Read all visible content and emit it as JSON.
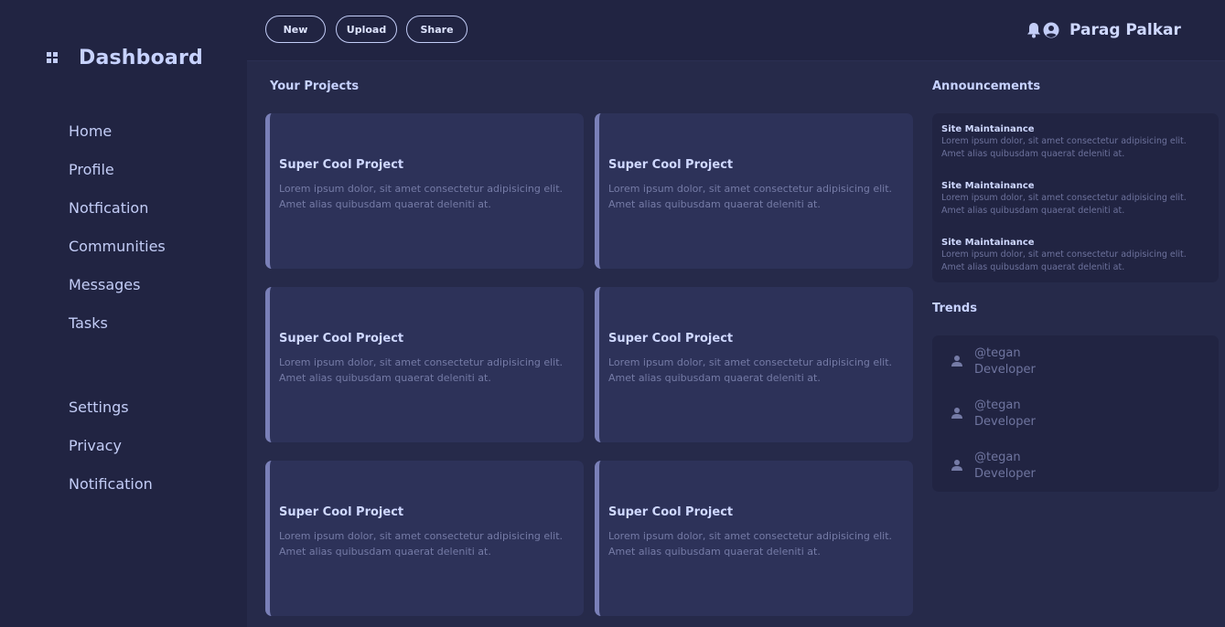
{
  "brand": {
    "title": "Dashboard",
    "icon": "grid-icon"
  },
  "nav": {
    "primary": [
      {
        "label": "Home"
      },
      {
        "label": "Profile"
      },
      {
        "label": "Notfication"
      },
      {
        "label": "Communities"
      },
      {
        "label": "Messages"
      },
      {
        "label": "Tasks"
      }
    ],
    "secondary": [
      {
        "label": "Settings"
      },
      {
        "label": "Privacy"
      },
      {
        "label": "Notification"
      }
    ]
  },
  "header": {
    "buttons": {
      "new": "New",
      "upload": "Upload",
      "share": "Share"
    },
    "user_name": "Parag Palkar",
    "icons": [
      "bell-icon",
      "user-circle-icon"
    ]
  },
  "projects": {
    "title": "Your Projects",
    "items": [
      {
        "title": "Super Cool Project",
        "line1": "Lorem ipsum dolor, sit amet consectetur adipisicing elit.",
        "line2": "Amet alias quibusdam quaerat deleniti at."
      },
      {
        "title": "Super Cool Project",
        "line1": "Lorem ipsum dolor, sit amet consectetur adipisicing elit.",
        "line2": "Amet alias quibusdam quaerat deleniti at."
      },
      {
        "title": "Super Cool Project",
        "line1": "Lorem ipsum dolor, sit amet consectetur adipisicing elit.",
        "line2": "Amet alias quibusdam quaerat deleniti at."
      },
      {
        "title": "Super Cool Project",
        "line1": "Lorem ipsum dolor, sit amet consectetur adipisicing elit.",
        "line2": "Amet alias quibusdam quaerat deleniti at."
      },
      {
        "title": "Super Cool Project",
        "line1": "Lorem ipsum dolor, sit amet consectetur adipisicing elit.",
        "line2": "Amet alias quibusdam quaerat deleniti at."
      },
      {
        "title": "Super Cool Project",
        "line1": "Lorem ipsum dolor, sit amet consectetur adipisicing elit.",
        "line2": "Amet alias quibusdam quaerat deleniti at."
      }
    ]
  },
  "announcements": {
    "title": "Announcements",
    "items": [
      {
        "title": "Site Maintainance",
        "line1": "Lorem ipsum dolor, sit amet consectetur adipisicing elit.",
        "line2": "Amet alias quibusdam quaerat deleniti at."
      },
      {
        "title": "Site Maintainance",
        "line1": "Lorem ipsum dolor, sit amet consectetur adipisicing elit.",
        "line2": "Amet alias quibusdam quaerat deleniti at."
      },
      {
        "title": "Site Maintainance",
        "line1": "Lorem ipsum dolor, sit amet consectetur adipisicing elit.",
        "line2": "Amet alias quibusdam quaerat deleniti at."
      }
    ]
  },
  "trends": {
    "title": "Trends",
    "items": [
      {
        "handle": "@tegan",
        "role": "Developer",
        "icon": "user-icon"
      },
      {
        "handle": "@tegan",
        "role": "Developer",
        "icon": "user-icon"
      },
      {
        "handle": "@tegan",
        "role": "Developer",
        "icon": "user-icon"
      }
    ]
  },
  "colors": {
    "background": "#262a4a",
    "sidebar": "#212442",
    "card": "#2d3259",
    "card_accent": "#7a80b8",
    "text_primary": "#c3cdf7",
    "text_muted": "#757ba6"
  }
}
